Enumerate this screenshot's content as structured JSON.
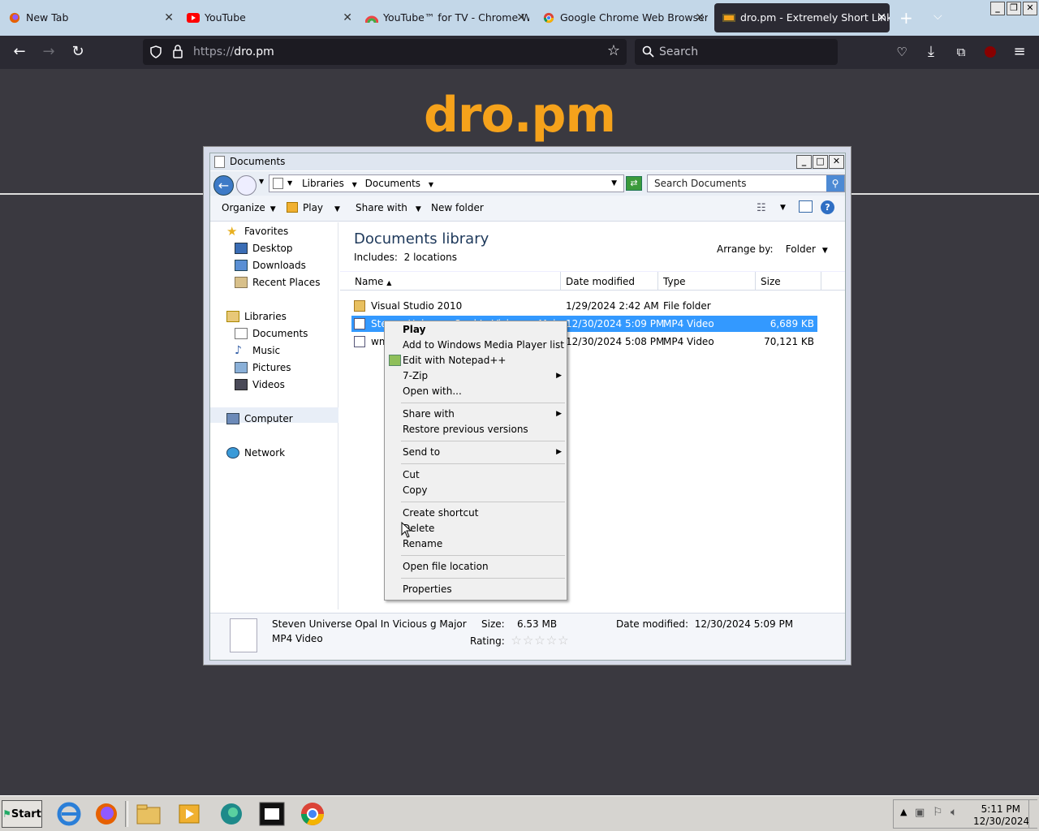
{
  "browser": {
    "tabs": [
      {
        "label": "New Tab"
      },
      {
        "label": "YouTube"
      },
      {
        "label": "YouTube™ for TV - Chrome W"
      },
      {
        "label": "Google Chrome Web Browser"
      },
      {
        "label": "dro.pm - Extremely Short Links"
      }
    ],
    "url_protocol": "https://",
    "url_host": "dro.pm",
    "search_placeholder": "Search",
    "colors": {
      "tabbar": "#c3d7e8",
      "toolbar": "#2b2a33",
      "page": "#3a3940"
    }
  },
  "page": {
    "logo": "dro.pm",
    "logo_color": "#f5a21b"
  },
  "explorer": {
    "title": "Documents",
    "address": {
      "crumb1": "Libraries",
      "crumb2": "Documents"
    },
    "search_placeholder": "Search Documents",
    "toolbar": {
      "organize": "Organize",
      "play": "Play",
      "share_with": "Share with",
      "new_folder": "New folder"
    },
    "nav": {
      "favorites": "Favorites",
      "desktop": "Desktop",
      "downloads": "Downloads",
      "recent": "Recent Places",
      "libraries": "Libraries",
      "documents": "Documents",
      "music": "Music",
      "pictures": "Pictures",
      "videos": "Videos",
      "computer": "Computer",
      "network": "Network"
    },
    "library": {
      "title": "Documents library",
      "includes_label": "Includes:",
      "includes_value": "2 locations",
      "arrange_label": "Arrange by:",
      "arrange_value": "Folder"
    },
    "columns": {
      "name": "Name",
      "date": "Date modified",
      "type": "Type",
      "size": "Size"
    },
    "files": [
      {
        "name": "Visual Studio 2010",
        "date": "1/29/2024 2:42 AM",
        "type": "File folder",
        "size": ""
      },
      {
        "name": "Steven Universe Opal In Vicious g Major",
        "date": "12/30/2024 5:09 PM",
        "type": "MP4 Video",
        "size": "6,689 KB"
      },
      {
        "name": "wm",
        "date": "12/30/2024 5:08 PM",
        "type": "MP4 Video",
        "size": "70,121 KB"
      }
    ],
    "details": {
      "filename": "Steven Universe Opal In Vicious g Major",
      "filetype": "MP4 Video",
      "size_label": "Size:",
      "size_value": "6.53 MB",
      "rating_label": "Rating:",
      "date_label": "Date modified:",
      "date_value": "12/30/2024 5:09 PM"
    }
  },
  "context_menu": {
    "play": "Play",
    "add_wmp": "Add to Windows Media Player list",
    "notepad": "Edit with Notepad++",
    "zip": "7-Zip",
    "open_with": "Open with...",
    "share_with": "Share with",
    "restore": "Restore previous versions",
    "send_to": "Send to",
    "cut": "Cut",
    "copy": "Copy",
    "create_shortcut": "Create shortcut",
    "delete": "Delete",
    "rename": "Rename",
    "open_location": "Open file location",
    "properties": "Properties"
  },
  "taskbar": {
    "start": "Start",
    "time": "5:11 PM",
    "date": "12/30/2024"
  }
}
